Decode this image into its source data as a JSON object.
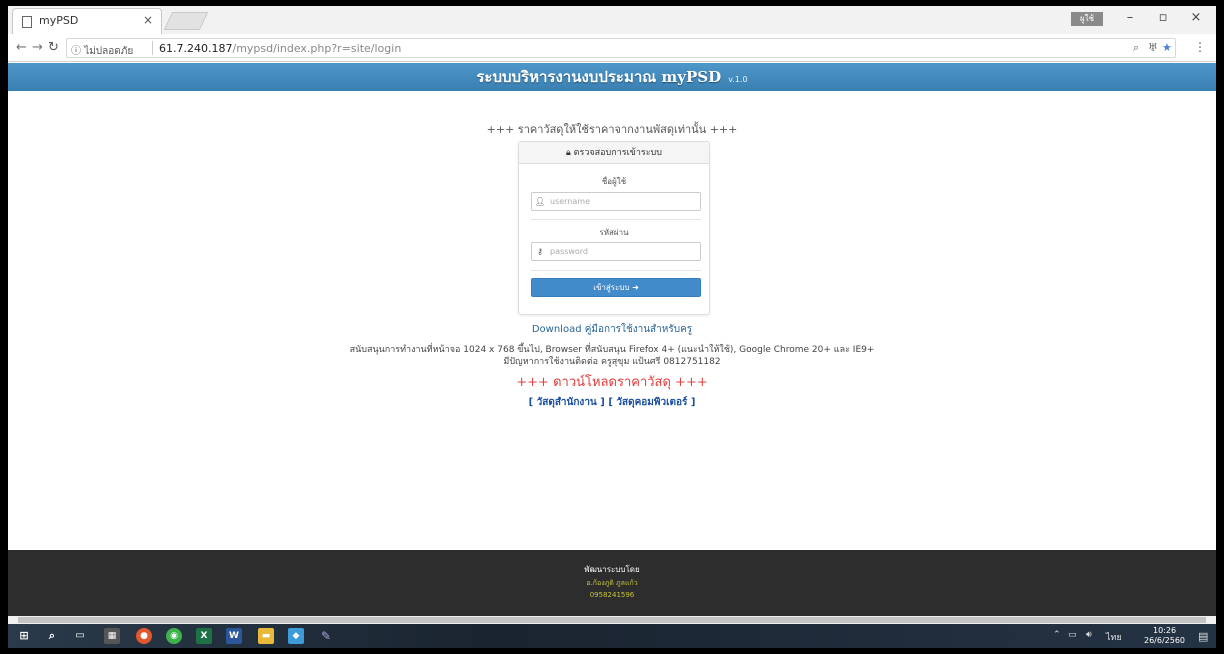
{
  "browser": {
    "tab_title": "myPSD",
    "tab_close": "×",
    "secure_label": "ไม่ปลอดภัย",
    "url_host": "61.7.240.187",
    "url_path": "/mypsd/index.php?r=site/login",
    "user_badge": "ผูใช้",
    "minimize": "–",
    "maximize": "▫",
    "close": "×"
  },
  "banner": {
    "title": "ระบบบริหารงานงบประมาณ myPSD",
    "version": "v.1.0"
  },
  "notice": "+++ ราคาวัสดุให้ใช้ราคาจากงานพัสดุเท่านั้น +++",
  "login": {
    "heading": "ตรวจสอบการเข้าระบบ",
    "username_label": "ชื่อผู้ใช้",
    "username_placeholder": "username",
    "password_label": "รหัสผ่าน",
    "password_placeholder": "password",
    "submit_label": "เข้าสู่ระบบ"
  },
  "manual_link": "Download คู่มือการใช้งานสำหรับครู",
  "support_line1": "สนับสนุนการทำงานที่หน้าจอ 1024 x 768 ขึ้นไป, Browser ที่สนับสนุน Firefox 4+ (แนะนำให้ใช้), Google Chrome 20+ และ IE9+",
  "support_line2": "มีปัญหาการใช้งานติดต่อ ครูสุขุม แป้นศรี 0812751182",
  "download_title": "+++ ดาวน์โหลดราคาวัสดุ +++",
  "download_links": {
    "office": "[ วัสดุสำนักงาน ]",
    "computer": "[ วัสดุคอมพิวเตอร์ ]"
  },
  "footer": {
    "line1": "พัฒนาระบบโดย",
    "line2": "อ.ก้องภูติ ภูลแก้ว",
    "line3": "0958241596"
  },
  "taskbar": {
    "lang": "ไทย",
    "time": "10:26",
    "date": "26/6/2560"
  },
  "colors": {
    "banner": "#3f86bb",
    "button": "#428bca",
    "download_title": "#e03c3c",
    "footer": "#2d2d2d"
  }
}
